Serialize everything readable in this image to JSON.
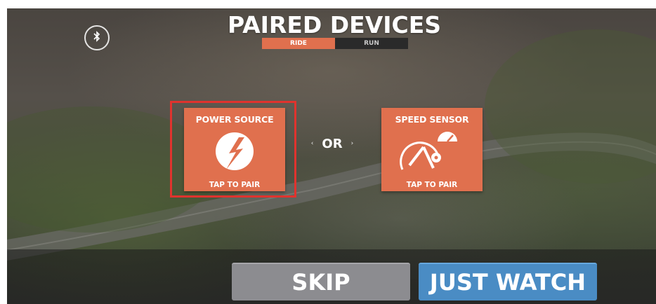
{
  "header": {
    "title": "PAIRED DEVICES",
    "bluetooth_icon": "bluetooth-icon"
  },
  "tabs": [
    {
      "label": "RIDE",
      "active": true
    },
    {
      "label": "RUN",
      "active": false
    }
  ],
  "cards": {
    "power": {
      "title": "POWER SOURCE",
      "footer": "TAP TO PAIR",
      "icon": "lightning-icon"
    },
    "speed": {
      "title": "SPEED SENSOR",
      "footer": "TAP TO PAIR",
      "icon": "speedometer-wheel-icon"
    }
  },
  "separator": {
    "label": "OR"
  },
  "actions": {
    "skip_label": "SKIP",
    "watch_label": "JUST WATCH"
  },
  "colors": {
    "accent_orange": "#e0704e",
    "highlight_red": "#e0332e",
    "watch_blue": "#4a8cc4",
    "skip_gray": "#8c8c90"
  }
}
